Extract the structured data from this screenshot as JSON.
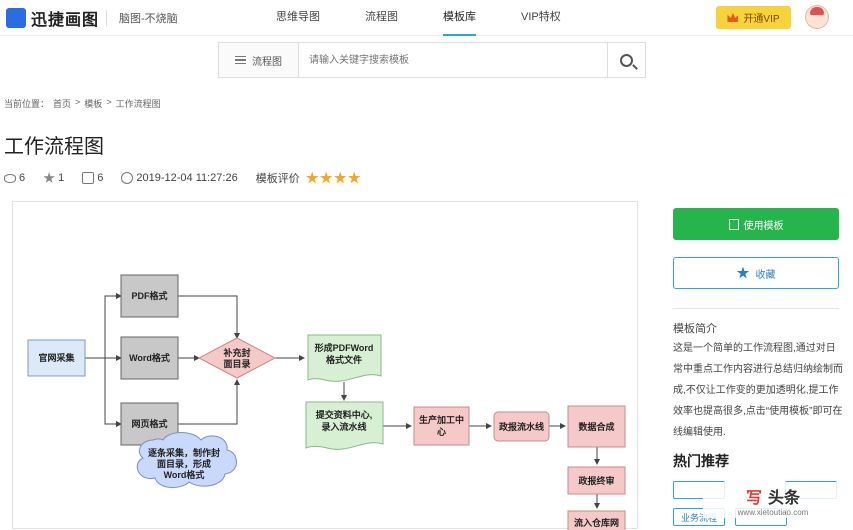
{
  "header": {
    "logo_text": "迅捷画图",
    "tagline": "脑图-不烧脑",
    "nav": [
      "思维导图",
      "流程图",
      "模板库",
      "VIP特权"
    ],
    "active_nav": 2,
    "vip_label": "开通VIP"
  },
  "search": {
    "category": "流程图",
    "placeholder": "请输入关键字搜索模板"
  },
  "breadcrumb": [
    "当前位置：",
    "首页",
    ">",
    "模板",
    ">",
    "工作流程图"
  ],
  "page_title": "工作流程图",
  "meta": {
    "views": "6",
    "favorites": "1",
    "edits": "6",
    "date": "2019-12-04 11:27:26",
    "rating_label": "模板评价",
    "rating": 4
  },
  "diagram": {
    "nodes": {
      "source": "官网采集",
      "pdf": "PDF格式",
      "word": "Word格式",
      "web": "网页格式",
      "supplement": [
        "补充封",
        "面目录"
      ],
      "cloud": [
        "逐条采集，制作封",
        "面目录，形成",
        "Word格式"
      ],
      "doc": [
        "形成PDFWord",
        "格式文件"
      ],
      "submit": [
        "提交资料中心,",
        "录入流水线"
      ],
      "produce": [
        "生产加工中",
        "心"
      ],
      "pipeline": "政报流水线",
      "merge": "数据合成",
      "terminal": "政报终审",
      "warehouse": "流入仓库网"
    }
  },
  "sidebar": {
    "use_label": "使用模板",
    "fav_label": "收藏",
    "intro_title": "模板简介",
    "intro_text": "这是一个简单的工作流程图,通过对日常中重点工作内容进行总结归纳绘制而成,不仅让工作变的更加透明化,提工作效率也提高很多,点击“使用模板”即可在线编辑使用.",
    "hot_title": "热门推荐",
    "tags": [
      "业务流程",
      "",
      "",
      ""
    ]
  },
  "watermark": {
    "mark": "写",
    "name": "头条",
    "url": "www.xietoutiao.com"
  },
  "colors": {
    "green": "#25b54c",
    "accent": "#2aa8d8",
    "gold": "#f5a623"
  }
}
